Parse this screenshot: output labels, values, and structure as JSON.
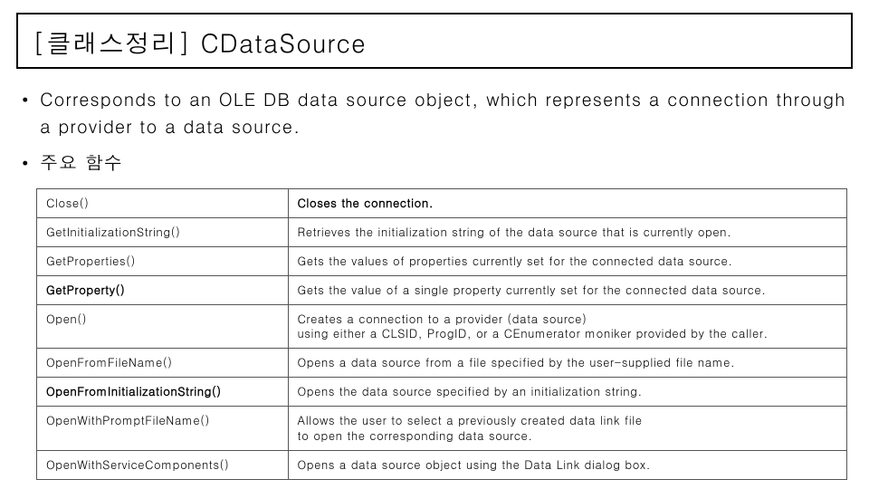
{
  "title": "[클래스정리] CDataSource",
  "bullets": [
    "Corresponds to an OLE DB data source object, which represents a connection through a provider to a data source.",
    "주요 함수"
  ],
  "rows": [
    {
      "fn": "Close()",
      "fn_bold": false,
      "desc": "Closes the connection.",
      "desc_bold": true
    },
    {
      "fn": "GetInitializationString()",
      "fn_bold": false,
      "desc": "Retrieves the initialization string of the data source that is currently open.",
      "desc_bold": false
    },
    {
      "fn": "GetProperties()",
      "fn_bold": false,
      "desc": "Gets the values of properties currently set for the connected data source.",
      "desc_bold": false
    },
    {
      "fn": "GetProperty()",
      "fn_bold": true,
      "desc": "Gets the value of a single property currently set for the connected data source.",
      "desc_bold": false
    },
    {
      "fn": "Open()",
      "fn_bold": false,
      "desc": "Creates a connection to a provider (data source)\nusing either a CLSID, ProgID, or a CEnumerator moniker provided by the caller.",
      "desc_bold": false
    },
    {
      "fn": "OpenFromFileName()",
      "fn_bold": false,
      "desc": "Opens a data source from a file specified by the user-supplied file name.",
      "desc_bold": false
    },
    {
      "fn": "OpenFromInitializationString()",
      "fn_bold": true,
      "desc": "Opens the data source specified by an initialization string.",
      "desc_bold": false
    },
    {
      "fn": "OpenWithPromptFileName()",
      "fn_bold": false,
      "desc": "Allows the user to select a previously created data link file\nto open the corresponding data source.",
      "desc_bold": false
    },
    {
      "fn": "OpenWithServiceComponents()",
      "fn_bold": false,
      "desc": "Opens a data source object using the Data Link dialog box.",
      "desc_bold": false
    }
  ]
}
